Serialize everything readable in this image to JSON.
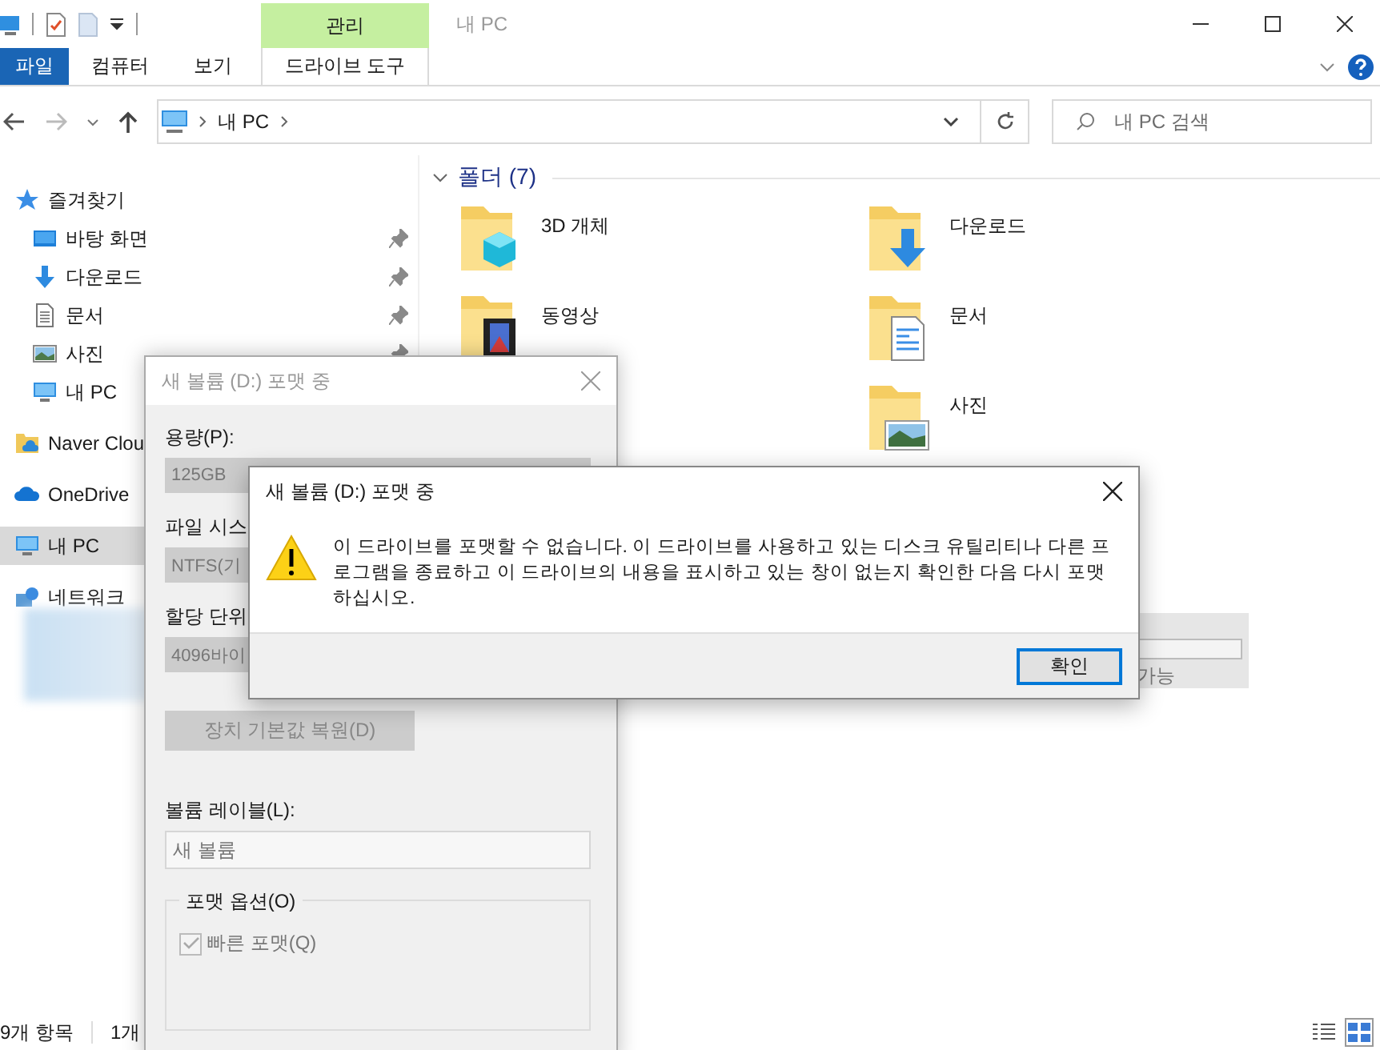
{
  "titlebar": {
    "context_group": "관리",
    "title": "내 PC"
  },
  "ribbon": {
    "tabs": [
      {
        "label": "파일",
        "kind": "file"
      },
      {
        "label": "컴퓨터",
        "kind": "tab"
      },
      {
        "label": "보기",
        "kind": "tab"
      },
      {
        "label": "드라이브 도구",
        "kind": "context"
      }
    ]
  },
  "address": {
    "crumbs": [
      "내 PC"
    ]
  },
  "search": {
    "placeholder": "내 PC 검색"
  },
  "sidebar": {
    "sections": [
      {
        "label": "즐겨찾기",
        "kind": "star",
        "selected": false,
        "children": [
          {
            "label": "바탕 화면",
            "kind": "desktop",
            "pinned": true
          },
          {
            "label": "다운로드",
            "kind": "download",
            "pinned": true
          },
          {
            "label": "문서",
            "kind": "document",
            "pinned": true
          },
          {
            "label": "사진",
            "kind": "picture",
            "pinned": true
          },
          {
            "label": "내 PC",
            "kind": "pc"
          }
        ]
      },
      {
        "label": "Naver Clou",
        "kind": "cloud-folder",
        "selected": false
      },
      {
        "label": "OneDrive",
        "kind": "cloud",
        "selected": false
      },
      {
        "label": "내 PC",
        "kind": "pc",
        "selected": true
      },
      {
        "label": "네트워크",
        "kind": "network",
        "selected": false
      }
    ]
  },
  "content": {
    "group": {
      "label": "폴더 (7)",
      "expanded": true
    },
    "columns": [
      [
        {
          "label": "3D 개체",
          "kind": "cube"
        },
        {
          "label": "동영상",
          "kind": "video"
        }
      ],
      [
        {
          "label": "다운로드",
          "kind": "download"
        },
        {
          "label": "문서",
          "kind": "document"
        },
        {
          "label": "사진",
          "kind": "picture"
        }
      ]
    ]
  },
  "drive_fragment": {
    "text": "가능"
  },
  "status_bar": {
    "items": [
      "9개 항목",
      "1개"
    ],
    "views": [
      {
        "kind": "details",
        "selected": false
      },
      {
        "kind": "tiles",
        "selected": true
      }
    ]
  },
  "format_dialog": {
    "title": "새 볼륨 (D:) 포맷 중",
    "active": false,
    "fields": [
      {
        "label": "용량(P):",
        "value": "125GB",
        "disabled": true
      },
      {
        "label": "파일 시스",
        "value": "NTFS(기",
        "disabled": true
      },
      {
        "label": "할당 단위",
        "value": "4096바이",
        "disabled": true
      }
    ],
    "restore_button": {
      "label": "장치 기본값 복원(D)",
      "disabled": true
    },
    "volume_label": {
      "label": "볼륨 레이블(L):",
      "value": "새 볼륨"
    },
    "options": {
      "legend": "포맷 옵션(O)",
      "items": [
        {
          "label": "빠른 포맷(Q)",
          "checked": true,
          "disabled": true
        }
      ]
    }
  },
  "message_box": {
    "title": "새 볼륨 (D:) 포맷 중",
    "message": "이 드라이브를 포맷할 수 없습니다. 이 드라이브를 사용하고 있는 디스크 유틸리티나 다른 프로그램을 종료하고 이 드라이브의 내용을 표시하고 있는 창이 없는지 확인한 다음 다시 포맷하십시오.",
    "buttons": [
      {
        "label": "확인",
        "default": true
      }
    ]
  }
}
